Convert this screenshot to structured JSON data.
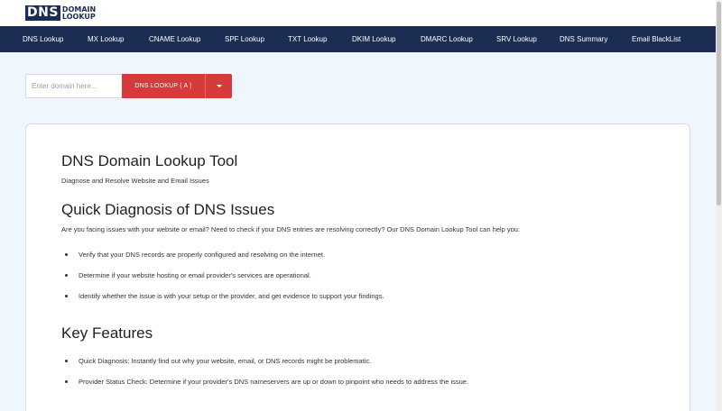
{
  "logo": {
    "box": "DNS",
    "line1": "DOMAIN",
    "line2": "LOOKUP"
  },
  "nav": {
    "items": [
      {
        "label": "DNS Lookup"
      },
      {
        "label": "MX Lookup"
      },
      {
        "label": "CNAME Lookup"
      },
      {
        "label": "SPF Lookup"
      },
      {
        "label": "TXT Lookup"
      },
      {
        "label": "DKIM Lookup"
      },
      {
        "label": "DMARC Lookup"
      },
      {
        "label": "SRV Lookup"
      },
      {
        "label": "DNS Summary"
      },
      {
        "label": "Email BlackList"
      }
    ]
  },
  "search": {
    "placeholder": "Enter domain here...",
    "value": "",
    "button_label": "DNS LOOKUP ( A )",
    "dropdown_icon": "chevron-down-icon"
  },
  "main": {
    "title": "DNS Domain Lookup Tool",
    "subtitle": "Diagnose and Resolve Website and Email Issues",
    "section1": {
      "heading": "Quick Diagnosis of DNS Issues",
      "intro": "Are you facing issues with your website or email? Need to check if your DNS entries are resolving correctly? Our DNS Domain Lookup Tool can help you:",
      "bullets": [
        "Verify that your DNS records are properly configured and resolving on the internet.",
        "Determine if your website hosting or email provider's services are operational.",
        "Identify whether the issue is with your setup or the provider, and get evidence to support your findings."
      ]
    },
    "section2": {
      "heading": "Key Features",
      "bullets": [
        "Quick Diagnosis: Instantly find out why your website, email, or DNS records might be problematic.",
        "Provider Status Check: Determine if your provider's DNS nameservers are up or down to pinpoint who needs to address the issue."
      ]
    }
  },
  "colors": {
    "nav_bg": "#1b2d52",
    "accent": "#d63a3a",
    "page_bg": "#f0f6fd"
  }
}
